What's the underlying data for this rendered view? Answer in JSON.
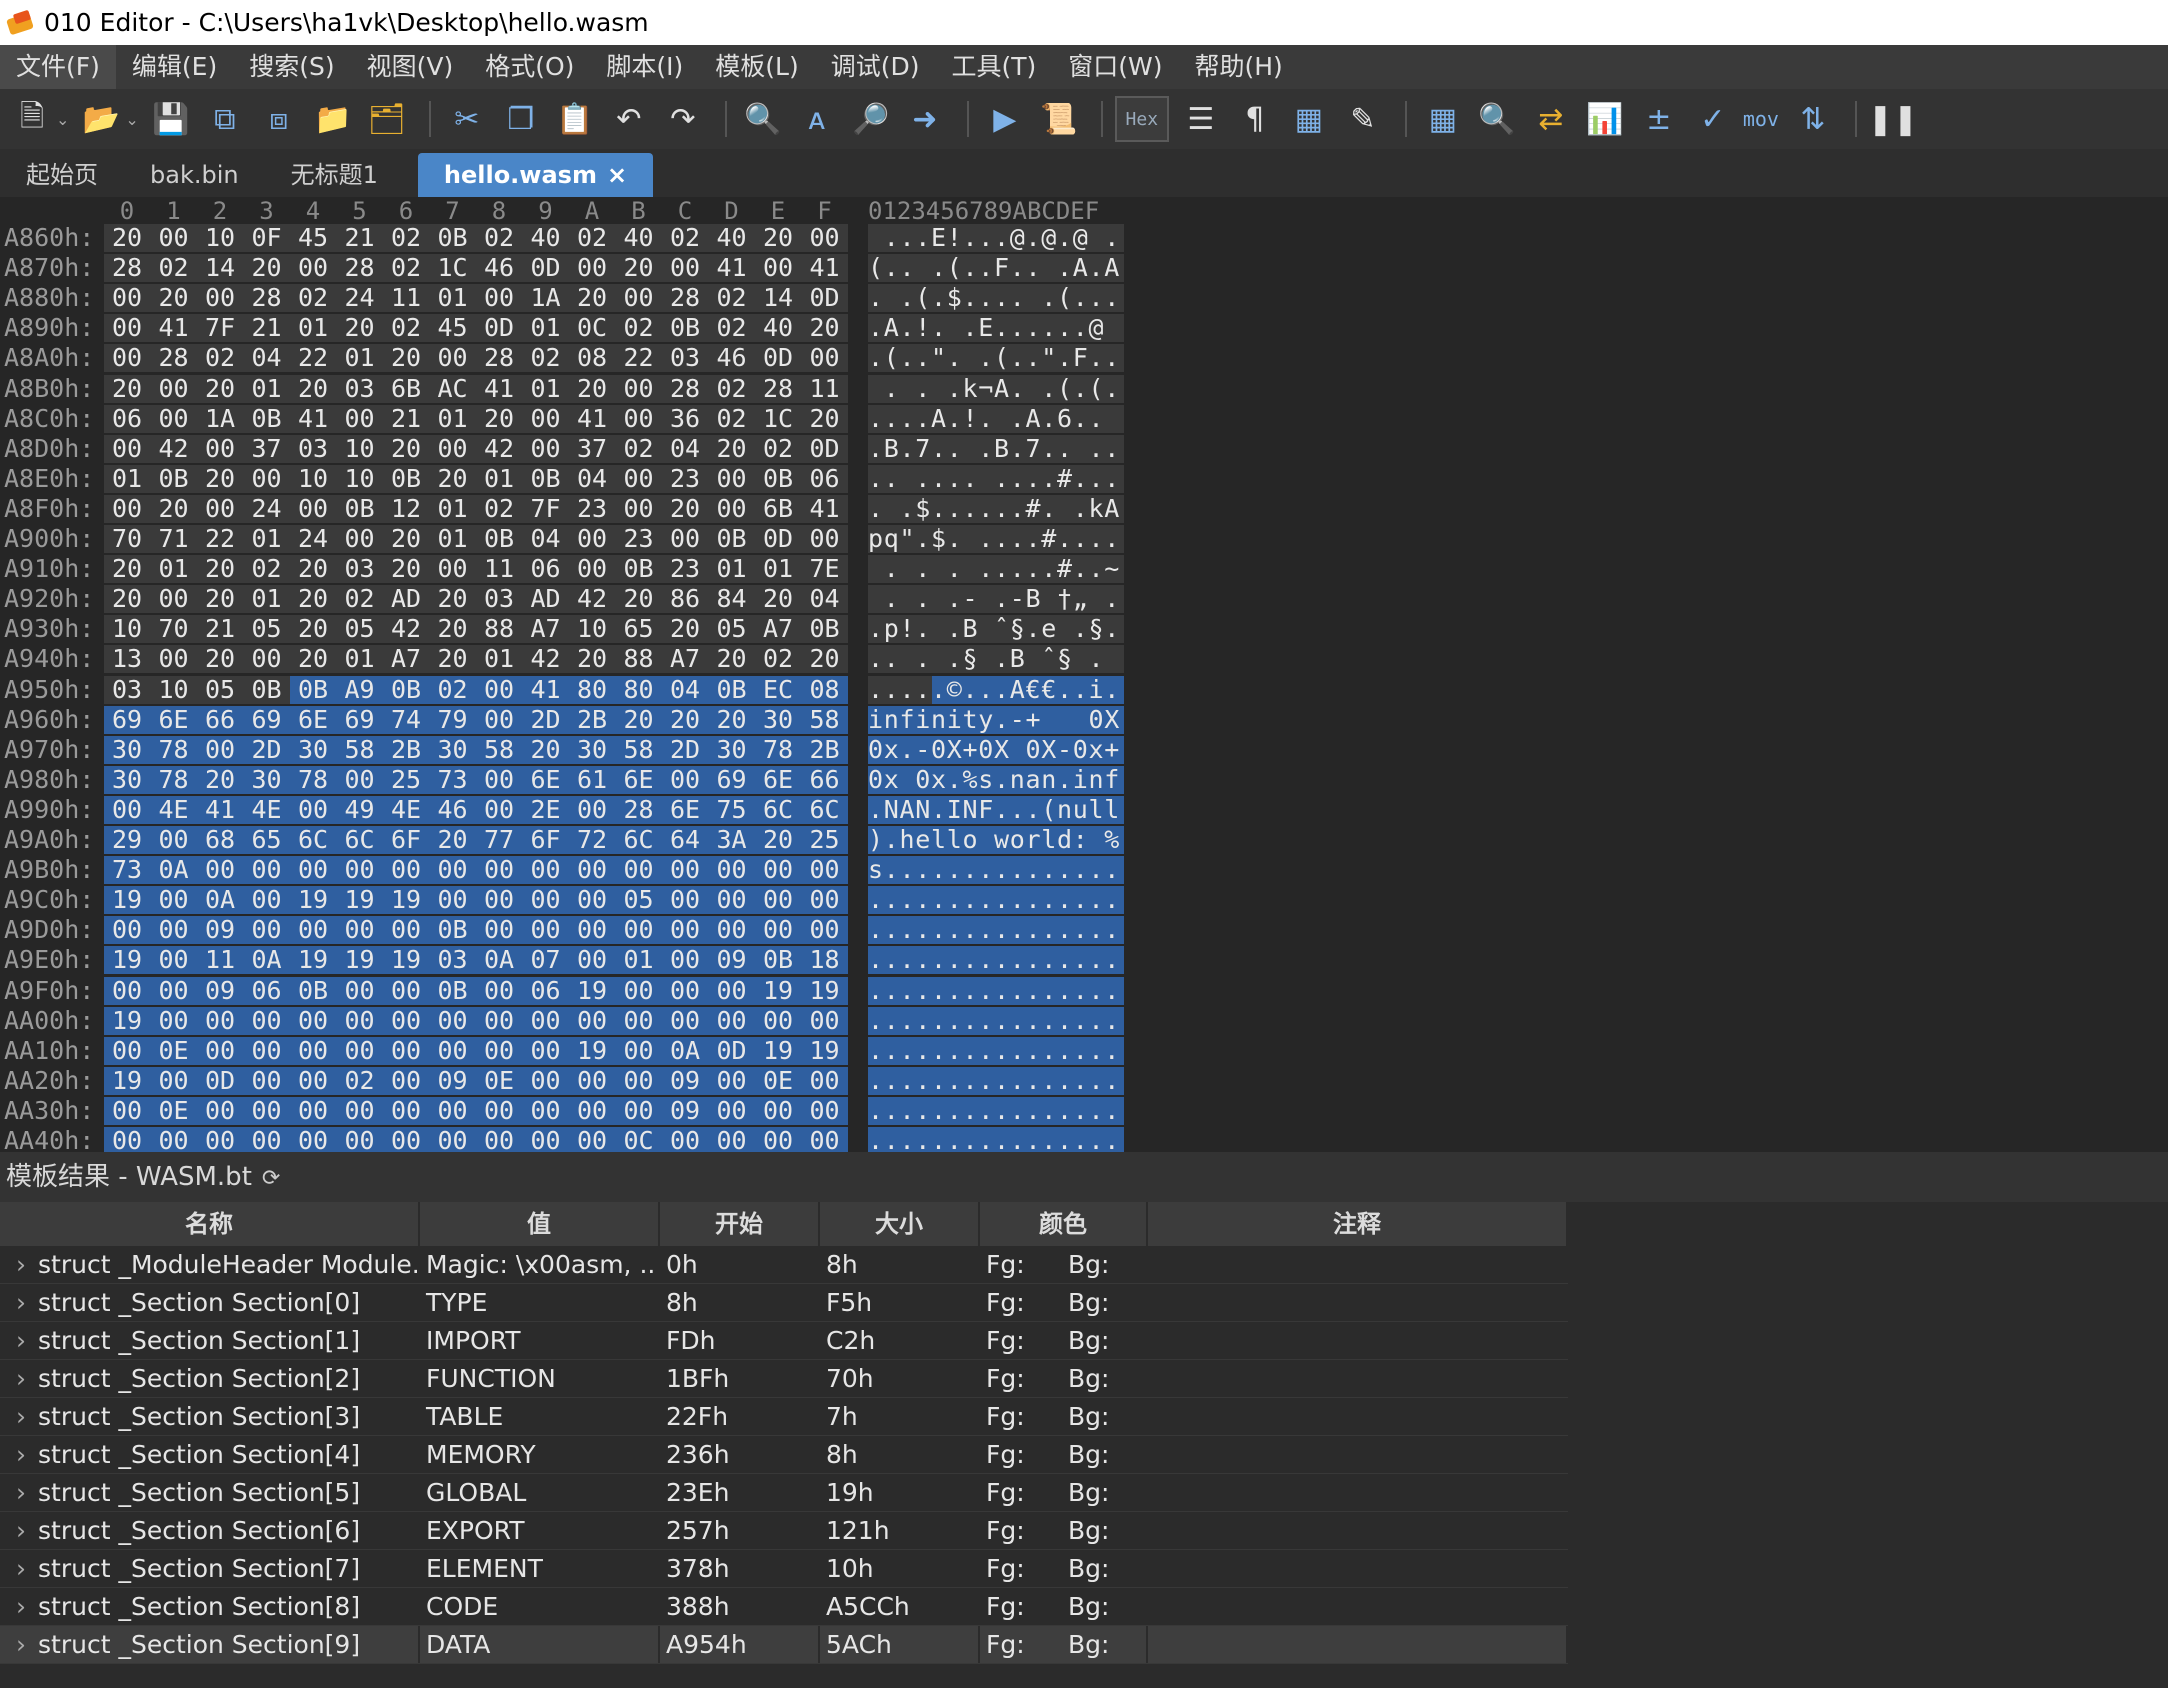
{
  "window": {
    "title": "010 Editor - C:\\Users\\ha1vk\\Desktop\\hello.wasm"
  },
  "menu": [
    "文件(F)",
    "编辑(E)",
    "搜索(S)",
    "视图(V)",
    "格式(O)",
    "脚本(I)",
    "模板(L)",
    "调试(D)",
    "工具(T)",
    "窗口(W)",
    "帮助(H)"
  ],
  "toolbar": {
    "hex_label": "Hex",
    "mov_label": "mov"
  },
  "tabs": [
    {
      "label": "起始页"
    },
    {
      "label": "bak.bin"
    },
    {
      "label": "无标题1"
    },
    {
      "label": "hello.wasm",
      "close": "×"
    }
  ],
  "hex": {
    "columns": [
      "0",
      "1",
      "2",
      "3",
      "4",
      "5",
      "6",
      "7",
      "8",
      "9",
      "A",
      "B",
      "C",
      "D",
      "E",
      "F"
    ],
    "ascii_header": "0123456789ABCDEF",
    "rows": [
      {
        "addr": "A860h:",
        "bytes": "20 00 10 0F 45 21 02 0B 02 40 02 40 02 40 20 00",
        "ascii": " ...E!...@.@.@ ."
      },
      {
        "addr": "A870h:",
        "bytes": "28 02 14 20 00 28 02 1C 46 0D 00 20 00 41 00 41",
        "ascii": "(.. .(..F.. .A.A"
      },
      {
        "addr": "A880h:",
        "bytes": "00 20 00 28 02 24 11 01 00 1A 20 00 28 02 14 0D",
        "ascii": ". .(.$.... .(..."
      },
      {
        "addr": "A890h:",
        "bytes": "00 41 7F 21 01 20 02 45 0D 01 0C 02 0B 02 40 20",
        "ascii": ".A.!. .E......@ "
      },
      {
        "addr": "A8A0h:",
        "bytes": "00 28 02 04 22 01 20 00 28 02 08 22 03 46 0D 00",
        "ascii": ".(..\". .(..\".F.."
      },
      {
        "addr": "A8B0h:",
        "bytes": "20 00 20 01 20 03 6B AC 41 01 20 00 28 02 28 11",
        "ascii": " . . .k¬A. .(.(."
      },
      {
        "addr": "A8C0h:",
        "bytes": "06 00 1A 0B 41 00 21 01 20 00 41 00 36 02 1C 20",
        "ascii": "....A.!. .A.6.. "
      },
      {
        "addr": "A8D0h:",
        "bytes": "00 42 00 37 03 10 20 00 42 00 37 02 04 20 02 0D",
        "ascii": ".B.7.. .B.7.. .."
      },
      {
        "addr": "A8E0h:",
        "bytes": "01 0B 20 00 10 10 0B 20 01 0B 04 00 23 00 0B 06",
        "ascii": ".. .... ....#..."
      },
      {
        "addr": "A8F0h:",
        "bytes": "00 20 00 24 00 0B 12 01 02 7F 23 00 20 00 6B 41",
        "ascii": ". .$......#. .kA"
      },
      {
        "addr": "A900h:",
        "bytes": "70 71 22 01 24 00 20 01 0B 04 00 23 00 0B 0D 00",
        "ascii": "pq\".$. ....#...."
      },
      {
        "addr": "A910h:",
        "bytes": "20 01 20 02 20 03 20 00 11 06 00 0B 23 01 01 7E",
        "ascii": " . . . .....#..~"
      },
      {
        "addr": "A920h:",
        "bytes": "20 00 20 01 20 02 AD 20 03 AD 42 20 86 84 20 04",
        "ascii": " . . .- .-B †„ ."
      },
      {
        "addr": "A930h:",
        "bytes": "10 70 21 05 20 05 42 20 88 A7 10 65 20 05 A7 0B",
        "ascii": ".p!. .B ˆ§.e .§."
      },
      {
        "addr": "A940h:",
        "bytes": "13 00 20 00 20 01 A7 20 01 42 20 88 A7 20 02 20",
        "ascii": ".. . .§ .B ˆ§ . "
      },
      {
        "addr": "A950h:",
        "bytes": "03 10 05 0B 0B A9 0B 02 00 41 80 80 04 0B EC 08",
        "ascii": ".....©...A€€..i."
      },
      {
        "addr": "A960h:",
        "bytes": "69 6E 66 69 6E 69 74 79 00 2D 2B 20 20 20 30 58",
        "ascii": "infinity.-+   0X"
      },
      {
        "addr": "A970h:",
        "bytes": "30 78 00 2D 30 58 2B 30 58 20 30 58 2D 30 78 2B",
        "ascii": "0x.-0X+0X 0X-0x+"
      },
      {
        "addr": "A980h:",
        "bytes": "30 78 20 30 78 00 25 73 00 6E 61 6E 00 69 6E 66",
        "ascii": "0x 0x.%s.nan.inf"
      },
      {
        "addr": "A990h:",
        "bytes": "00 4E 41 4E 00 49 4E 46 00 2E 00 28 6E 75 6C 6C",
        "ascii": ".NAN.INF...(null"
      },
      {
        "addr": "A9A0h:",
        "bytes": "29 00 68 65 6C 6C 6F 20 77 6F 72 6C 64 3A 20 25",
        "ascii": ").hello world: %"
      },
      {
        "addr": "A9B0h:",
        "bytes": "73 0A 00 00 00 00 00 00 00 00 00 00 00 00 00 00",
        "ascii": "s..............."
      },
      {
        "addr": "A9C0h:",
        "bytes": "19 00 0A 00 19 19 19 00 00 00 00 05 00 00 00 00",
        "ascii": "................"
      },
      {
        "addr": "A9D0h:",
        "bytes": "00 00 09 00 00 00 00 0B 00 00 00 00 00 00 00 00",
        "ascii": "................"
      },
      {
        "addr": "A9E0h:",
        "bytes": "19 00 11 0A 19 19 19 03 0A 07 00 01 00 09 0B 18",
        "ascii": "................"
      },
      {
        "addr": "A9F0h:",
        "bytes": "00 00 09 06 0B 00 00 0B 00 06 19 00 00 00 19 19",
        "ascii": "................"
      },
      {
        "addr": "AA00h:",
        "bytes": "19 00 00 00 00 00 00 00 00 00 00 00 00 00 00 00",
        "ascii": "................"
      },
      {
        "addr": "AA10h:",
        "bytes": "00 0E 00 00 00 00 00 00 00 00 19 00 0A 0D 19 19",
        "ascii": "................"
      },
      {
        "addr": "AA20h:",
        "bytes": "19 00 0D 00 00 02 00 09 0E 00 00 00 09 00 0E 00",
        "ascii": "................"
      },
      {
        "addr": "AA30h:",
        "bytes": "00 0E 00 00 00 00 00 00 00 00 00 00 09 00 00 00",
        "ascii": "................"
      },
      {
        "addr": "AA40h:",
        "bytes": "00 00 00 00 00 00 00 00 00 00 00 0C 00 00 00 00",
        "ascii": "................"
      }
    ],
    "selection_start_row": 15,
    "selection_start_col": 4
  },
  "template": {
    "title": "模板结果 - WASM.bt",
    "headers": {
      "name": "名称",
      "value": "值",
      "start": "开始",
      "size": "大小",
      "color": "颜色",
      "note": "注释"
    },
    "rows": [
      {
        "name": "struct _ModuleHeader Module...",
        "value": "Magic: \\x00asm, ...",
        "start": "0h",
        "size": "8h",
        "fg": "Fg:",
        "bg": "Bg:"
      },
      {
        "name": "struct _Section Section[0]",
        "value": "TYPE",
        "start": "8h",
        "size": "F5h",
        "fg": "Fg:",
        "bg": "Bg:"
      },
      {
        "name": "struct _Section Section[1]",
        "value": "IMPORT",
        "start": "FDh",
        "size": "C2h",
        "fg": "Fg:",
        "bg": "Bg:"
      },
      {
        "name": "struct _Section Section[2]",
        "value": "FUNCTION",
        "start": "1BFh",
        "size": "70h",
        "fg": "Fg:",
        "bg": "Bg:"
      },
      {
        "name": "struct _Section Section[3]",
        "value": "TABLE",
        "start": "22Fh",
        "size": "7h",
        "fg": "Fg:",
        "bg": "Bg:"
      },
      {
        "name": "struct _Section Section[4]",
        "value": "MEMORY",
        "start": "236h",
        "size": "8h",
        "fg": "Fg:",
        "bg": "Bg:"
      },
      {
        "name": "struct _Section Section[5]",
        "value": "GLOBAL",
        "start": "23Eh",
        "size": "19h",
        "fg": "Fg:",
        "bg": "Bg:"
      },
      {
        "name": "struct _Section Section[6]",
        "value": "EXPORT",
        "start": "257h",
        "size": "121h",
        "fg": "Fg:",
        "bg": "Bg:"
      },
      {
        "name": "struct _Section Section[7]",
        "value": "ELEMENT",
        "start": "378h",
        "size": "10h",
        "fg": "Fg:",
        "bg": "Bg:"
      },
      {
        "name": "struct _Section Section[8]",
        "value": "CODE",
        "start": "388h",
        "size": "A5CCh",
        "fg": "Fg:",
        "bg": "Bg:"
      },
      {
        "name": "struct _Section Section[9]",
        "value": "DATA",
        "start": "A954h",
        "size": "5ACh",
        "fg": "Fg:",
        "bg": "Bg:"
      }
    ],
    "selected_row": 10
  }
}
